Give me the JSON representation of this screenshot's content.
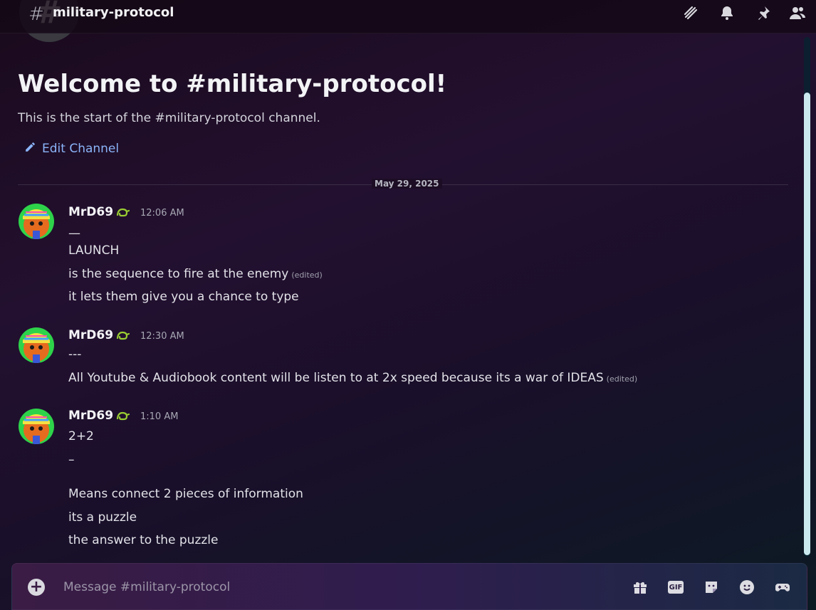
{
  "header": {
    "channel_name": "military-protocol",
    "hash_glyph": "#",
    "icons": [
      "threads-icon",
      "bell-icon",
      "pin-icon",
      "members-icon"
    ]
  },
  "welcome": {
    "hash_glyph": "#",
    "title": "Welcome to #military-protocol!",
    "subtitle": "This is the start of the #military-protocol channel.",
    "edit_label": "Edit Channel"
  },
  "divider": {
    "date": "May 29, 2025"
  },
  "messages": [
    {
      "author": "MrD69",
      "time": "12:06 AM",
      "lines": [
        "—",
        "LAUNCH",
        "is the sequence to fire at the enemy",
        "it lets them give you a chance to type"
      ],
      "edited_marker": "(edited)"
    },
    {
      "author": "MrD69",
      "time": "12:30 AM",
      "lines": [
        "---",
        "All Youtube & Audiobook content will be listen to at 2x speed because its a war of IDEAS"
      ],
      "edited_marker": "(edited)"
    },
    {
      "author": "MrD69",
      "time": "1:10 AM",
      "lines": [
        "2+2",
        "–",
        "Means connect 2 pieces of information",
        "its a puzzle",
        "the answer to the puzzle"
      ]
    }
  ],
  "composer": {
    "placeholder": "Message #military-protocol",
    "value": "",
    "icons": [
      "gift-icon",
      "gif-icon",
      "sticker-icon",
      "emoji-icon",
      "activity-icon"
    ],
    "gif_label": "GIF"
  },
  "colors": {
    "accent_link": "#8ab4f8",
    "scrollbar_thumb": "#c9e9ef"
  }
}
